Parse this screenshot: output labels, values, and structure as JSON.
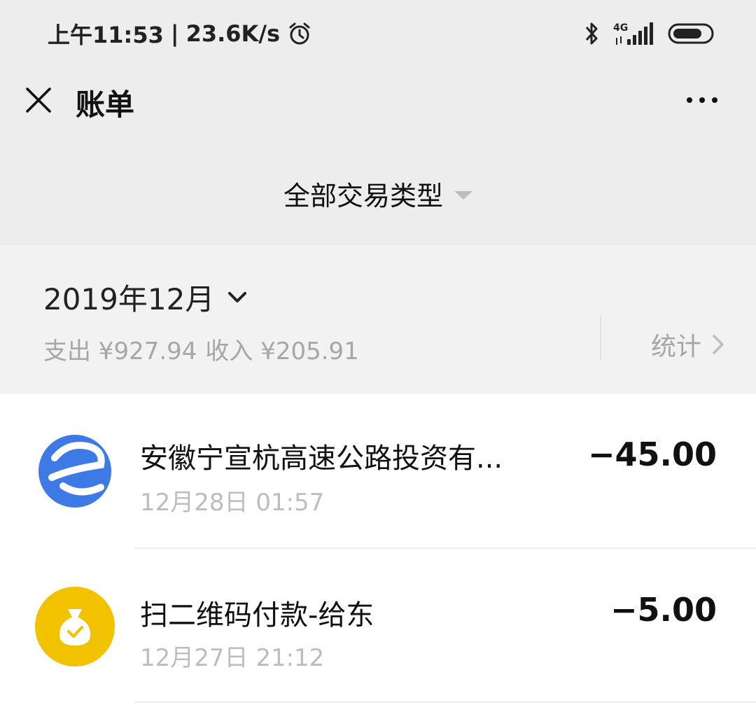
{
  "status_bar": {
    "time": "上午11:53",
    "separator": "|",
    "net_speed": "23.6K/s",
    "network": "4G"
  },
  "nav": {
    "title": "账单"
  },
  "filter": {
    "label": "全部交易类型"
  },
  "month_section": {
    "month": "2019年12月",
    "expense_label": "支出 ¥927.94",
    "income_label": "收入 ¥205.91",
    "stats_label": "统计"
  },
  "transactions": [
    {
      "title": "安徽宁宣杭高速公路投资有...",
      "time": "12月28日 01:57",
      "amount": "−45.00",
      "icon": "highway-e-logo-icon",
      "icon_color": "#3d7ae6"
    },
    {
      "title": "扫二维码付款-给东",
      "time": "12月27日 21:12",
      "amount": "−5.00",
      "icon": "money-bag-icon",
      "icon_color": "#f2c200"
    }
  ]
}
